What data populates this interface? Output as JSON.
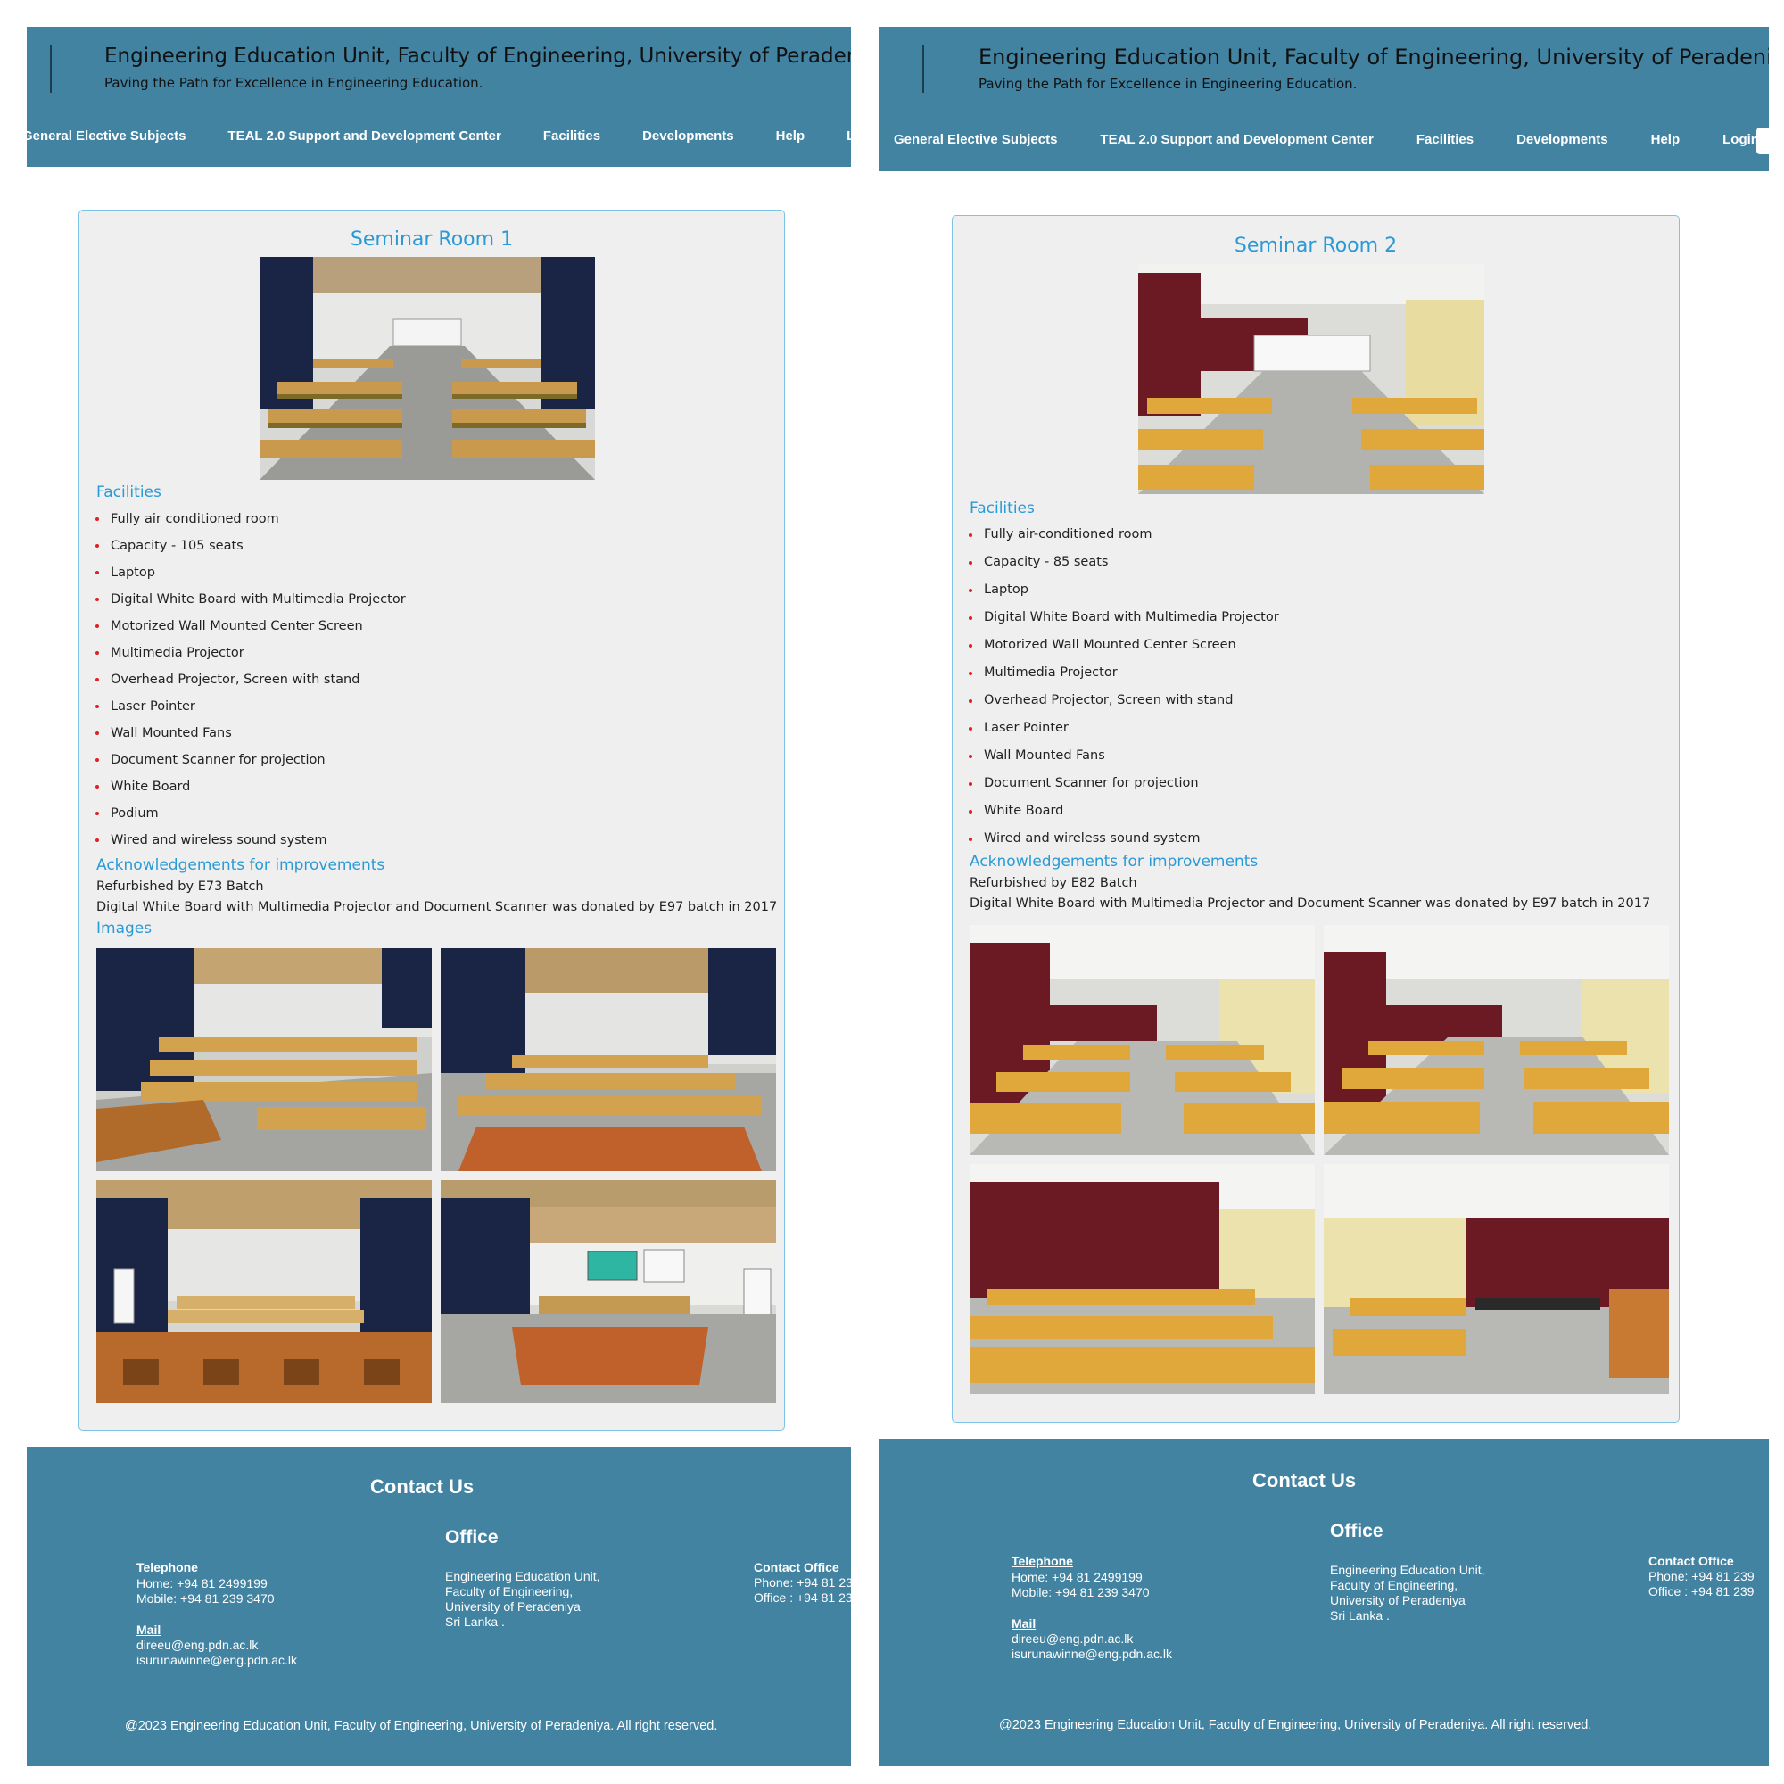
{
  "header": {
    "title": "Engineering Education Unit, Faculty of Engineering, University of Peradeniya.",
    "subtitle": "Paving the Path for Excellence in Engineering Education.",
    "nav": [
      "General Elective Subjects",
      "TEAL 2.0 Support and Development Center",
      "Facilities",
      "Developments",
      "Help",
      "Login"
    ]
  },
  "rooms": [
    {
      "title": "Seminar Room 1",
      "facilities_heading": "Facilities",
      "facilities": [
        "Fully air conditioned room",
        "Capacity - 105 seats",
        "Laptop",
        "Digital White Board with Multimedia Projector",
        "Motorized Wall Mounted Center Screen",
        "Multimedia Projector",
        "Overhead Projector, Screen with stand",
        "Laser Pointer",
        "Wall Mounted Fans",
        "Document Scanner for projection",
        "White Board",
        "Podium",
        "Wired and wireless sound system"
      ],
      "ack_heading": "Acknowledgements for improvements",
      "ack_lines": [
        "Refurbished by E73 Batch",
        "Digital White Board with Multimedia Projector and Document Scanner was donated by E97 batch in 2017"
      ],
      "images_heading": "Images"
    },
    {
      "title": "Seminar Room 2",
      "facilities_heading": "Facilities",
      "facilities": [
        "Fully air-conditioned room",
        "Capacity - 85 seats",
        "Laptop",
        "Digital White Board with Multimedia Projector",
        "Motorized Wall Mounted Center Screen",
        "Multimedia Projector",
        "Overhead Projector, Screen with stand",
        "Laser Pointer",
        "Wall Mounted Fans",
        "Document Scanner for projection",
        "White Board",
        "Wired and wireless sound system"
      ],
      "ack_heading": "Acknowledgements for improvements",
      "ack_lines": [
        "Refurbished by E82 Batch",
        "Digital White Board with Multimedia Projector and Document Scanner was donated by E97 batch in 2017"
      ]
    }
  ],
  "footer": {
    "title": "Contact Us",
    "office_heading": "Office",
    "telephone_label": "Telephone",
    "telephone_home": "Home: +94 81 2499199",
    "telephone_mobile": "Mobile: +94 81 239 3470",
    "mail_label": "Mail",
    "mail_1": "direeu@eng.pdn.ac.lk",
    "mail_2": "isurunawinne@eng.pdn.ac.lk",
    "office_address": [
      "Engineering Education Unit,",
      "Faculty of Engineering,",
      "University of Peradeniya",
      "Sri Lanka ."
    ],
    "contact_office_label": "Contact Office",
    "contact_office_phone": "Phone: +94 81 239",
    "contact_office_office": "Office : +94 81 239",
    "copyright": "@2023 Engineering Education Unit, Faculty of Engineering, University of Peradeniya. All right reserved."
  },
  "colors": {
    "header_bg": "#4383a2",
    "accent": "#2a9ad6",
    "bullet": "#e02020",
    "card_bg": "#efefef",
    "card_border": "#7cc3e6",
    "curtain_room1": "#1a2444",
    "curtain_room2": "#6b1a24",
    "chair": "#d9a441"
  }
}
